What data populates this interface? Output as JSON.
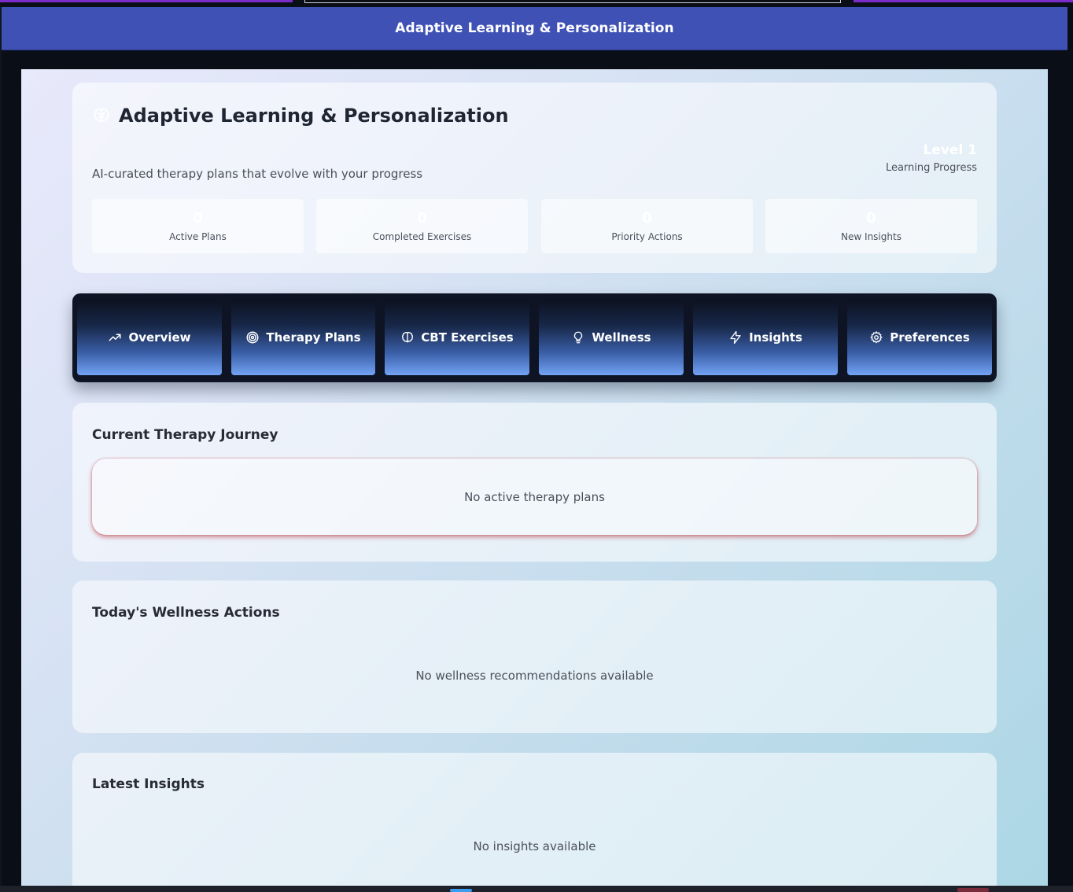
{
  "app_bar": {
    "title": "Adaptive Learning & Personalization"
  },
  "header": {
    "title": "Adaptive Learning & Personalization",
    "icon": "brain-icon",
    "subtitle": "AI-curated therapy plans that evolve with your progress",
    "level": "Level 1",
    "level_label": "Learning Progress"
  },
  "stats": [
    {
      "value": "0",
      "label": "Active Plans"
    },
    {
      "value": "0",
      "label": "Completed Exercises"
    },
    {
      "value": "0",
      "label": "Priority Actions"
    },
    {
      "value": "0",
      "label": "New Insights"
    }
  ],
  "tabs": [
    {
      "label": "Overview",
      "icon": "trending-up-icon"
    },
    {
      "label": "Therapy Plans",
      "icon": "target-icon"
    },
    {
      "label": "CBT Exercises",
      "icon": "brain-icon"
    },
    {
      "label": "Wellness",
      "icon": "lightbulb-icon"
    },
    {
      "label": "Insights",
      "icon": "zap-icon"
    },
    {
      "label": "Preferences",
      "icon": "gear-icon"
    }
  ],
  "sections": {
    "journey": {
      "title": "Current Therapy Journey",
      "empty": "No active therapy plans"
    },
    "wellness": {
      "title": "Today's Wellness Actions",
      "empty": "No wellness recommendations available"
    },
    "insights": {
      "title": "Latest Insights",
      "empty": "No insights available"
    }
  },
  "colors": {
    "app_bar": "#3f51b5",
    "tab_gradient_top": "#0c111f",
    "tab_gradient_bottom": "#73a3f5",
    "journey_glow": "#be3c46"
  }
}
